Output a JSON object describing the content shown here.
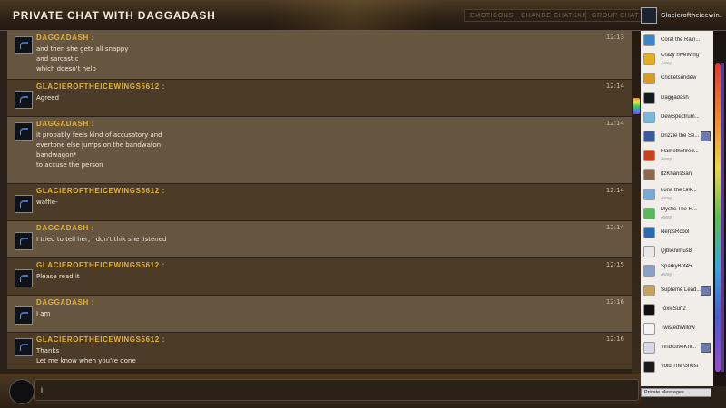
{
  "header": {
    "title": "PRIVATE CHAT WITH DAGGADASH",
    "buttons": [
      "EMOTICONS",
      "CHANGE CHATSKIN",
      "GROUP CHAT"
    ],
    "current_user": "Glacieroftheicewin..."
  },
  "messages": [
    {
      "user": "DAGGADASH :",
      "time": "12:13",
      "lines": [
        "and then she gets all snappy",
        "and sarcastic",
        "which doesn't help"
      ]
    },
    {
      "user": "GLACIEROFTHEICEWINGS5612 :",
      "time": "12:14",
      "lines": [
        "Agreed"
      ]
    },
    {
      "user": "DAGGADASH :",
      "time": "12:14",
      "lines": [
        "it probably feels kind of accusatory and",
        "evertone else jumps on the bandwafon",
        "bandwagon*",
        "to accuse the person"
      ]
    },
    {
      "user": "GLACIEROFTHEICEWINGS5612 :",
      "time": "12:14",
      "lines": [
        "waffle-"
      ]
    },
    {
      "user": "DAGGADASH :",
      "time": "12:14",
      "lines": [
        "I tried to tell her, I don't thik she listened"
      ]
    },
    {
      "user": "GLACIEROFTHEICEWINGS5612 :",
      "time": "12:15",
      "lines": [
        "Please read it"
      ]
    },
    {
      "user": "DAGGADASH :",
      "time": "12:16",
      "lines": [
        "I am"
      ]
    },
    {
      "user": "GLACIEROFTHEICEWINGS5612 :",
      "time": "12:16",
      "lines": [
        "Thanks",
        "Let me know when you're done"
      ]
    }
  ],
  "input": {
    "value": "i",
    "placeholder": ""
  },
  "userlist": [
    {
      "name": "Coral the Rain...",
      "status": "",
      "badge": false,
      "color": "#3a86c8"
    },
    {
      "name": "Crazy hiveWing",
      "status": "Away",
      "badge": false,
      "color": "#e0b020"
    },
    {
      "name": "Cricketsundew",
      "status": "",
      "badge": false,
      "color": "#d89a2a"
    },
    {
      "name": "Daggadash",
      "status": "",
      "badge": false,
      "color": "#141820"
    },
    {
      "name": "DewSpectrum...",
      "status": "",
      "badge": false,
      "color": "#7ab8d8"
    },
    {
      "name": "Drizzle the Se...",
      "status": "",
      "badge": true,
      "color": "#3a5aa0"
    },
    {
      "name": "Flamethefired...",
      "status": "Away",
      "badge": false,
      "color": "#c84020"
    },
    {
      "name": "ItzKharisSan",
      "status": "",
      "badge": false,
      "color": "#8a6a48"
    },
    {
      "name": "Luna the Silk...",
      "status": "Away",
      "badge": false,
      "color": "#7aa8d8"
    },
    {
      "name": "Mystic The H...",
      "status": "Away",
      "badge": false,
      "color": "#5ab860"
    },
    {
      "name": "NerdsRcool",
      "status": "",
      "badge": false,
      "color": "#2a6ab0"
    },
    {
      "name": "QjblAnimus8",
      "status": "",
      "badge": false,
      "color": "#e8e8e8"
    },
    {
      "name": "SparkyBot45",
      "status": "Away",
      "badge": false,
      "color": "#8aa0c8"
    },
    {
      "name": "Supreme Lead...",
      "status": "",
      "badge": true,
      "color": "#c8a060"
    },
    {
      "name": "ToxicSun2",
      "status": "",
      "badge": false,
      "color": "#111111"
    },
    {
      "name": "TwistedWillow",
      "status": "",
      "badge": false,
      "color": "#f4f4f4"
    },
    {
      "name": "VindictiveKni...",
      "status": "",
      "badge": true,
      "color": "#d8d8e8"
    },
    {
      "name": "Void The Ghost",
      "status": "",
      "badge": false,
      "color": "#1a1a1a"
    }
  ],
  "private_messages_label": "Private Messages"
}
